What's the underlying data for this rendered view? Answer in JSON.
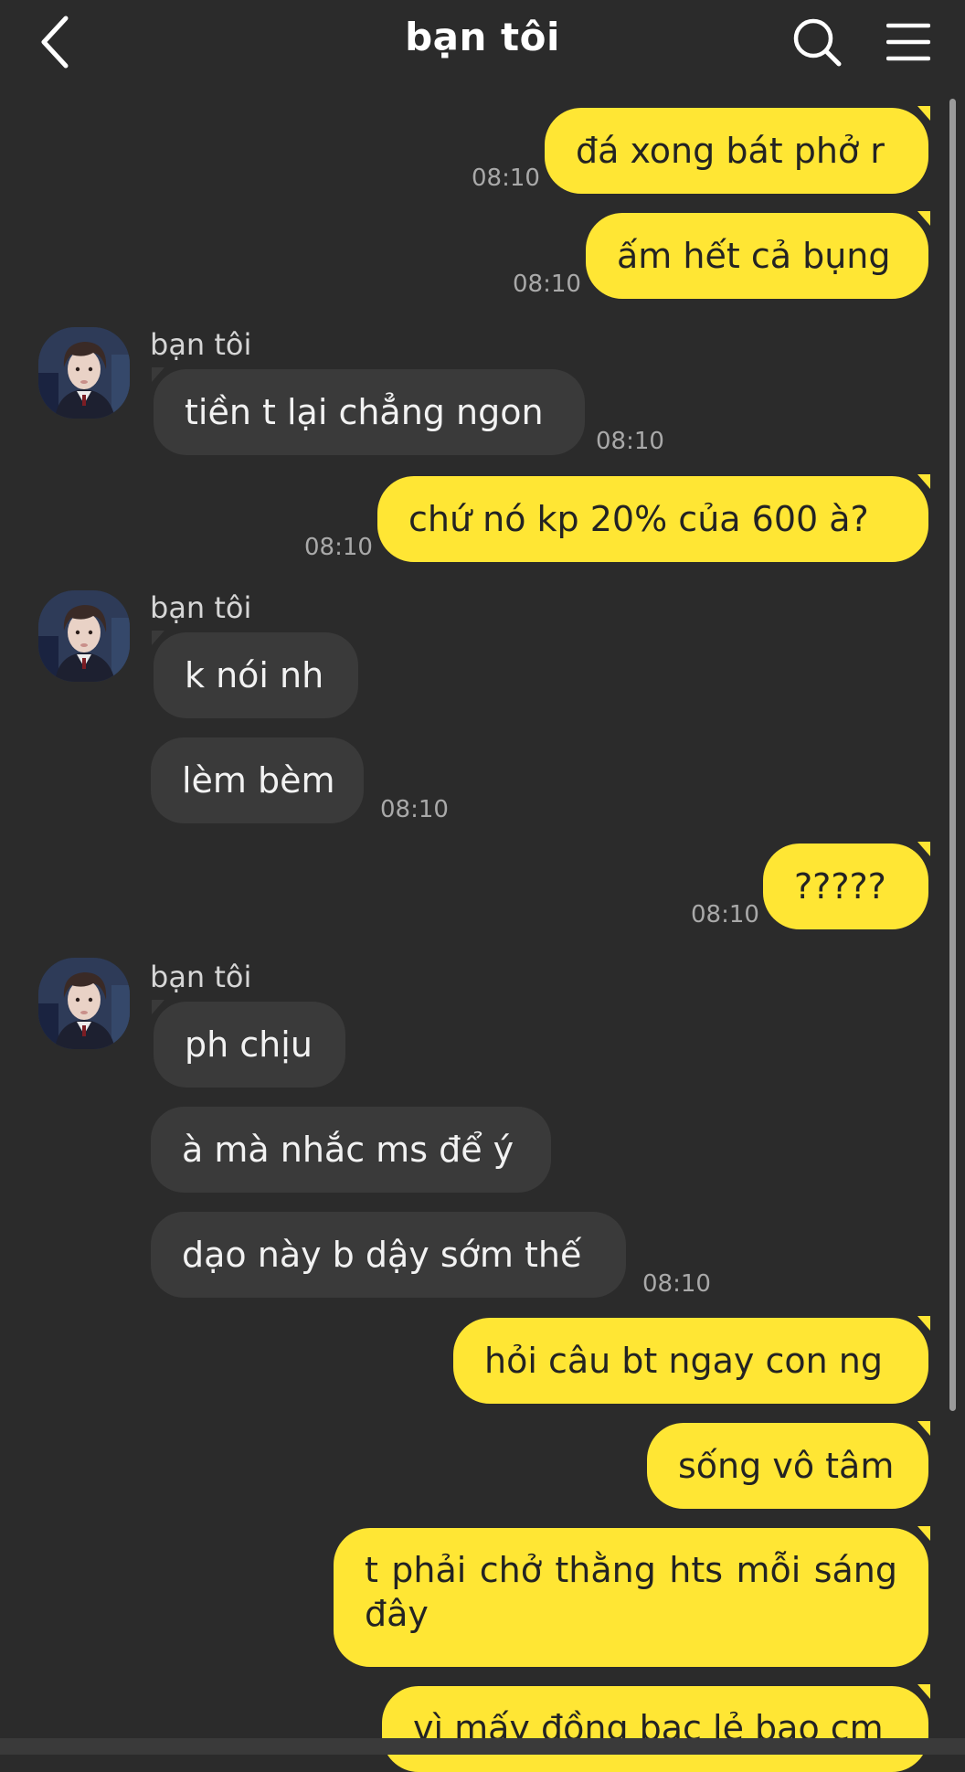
{
  "header": {
    "title": "bạn tôi"
  },
  "contact": {
    "name": "bạn tôi"
  },
  "messages": {
    "m1": {
      "text": "đá xong bát phở r",
      "time": "08:10"
    },
    "m2": {
      "text": "ấm hết cả bụng",
      "time": "08:10"
    },
    "m3": {
      "text": "tiền t lại chẳng ngon",
      "time": "08:10"
    },
    "m4": {
      "text": "chứ nó kp 20% của 600 à?",
      "time": "08:10"
    },
    "m5": {
      "text": "k nói nh"
    },
    "m6": {
      "text": "lèm bèm",
      "time": "08:10"
    },
    "m7": {
      "text": "?????",
      "time": "08:10"
    },
    "m8": {
      "text": "ph chịu"
    },
    "m9": {
      "text": "à mà nhắc ms để ý"
    },
    "m10": {
      "text": "dạo này b dậy sớm thế",
      "time": "08:10"
    },
    "m11": {
      "text": "hỏi câu bt ngay con ng"
    },
    "m12": {
      "text": "sống vô tâm"
    },
    "m13": {
      "text": "t phải chở thằng hts mỗi sáng đây"
    },
    "m14": {
      "text": "vì mấy đồng bạc lẻ bao cm"
    }
  },
  "colors": {
    "outgoing": "#ffe634",
    "incoming": "#3a3a3a",
    "background": "#2b2b2b"
  },
  "icons": {
    "back": "chevron-left-icon",
    "search": "search-icon",
    "menu": "hamburger-menu-icon"
  }
}
